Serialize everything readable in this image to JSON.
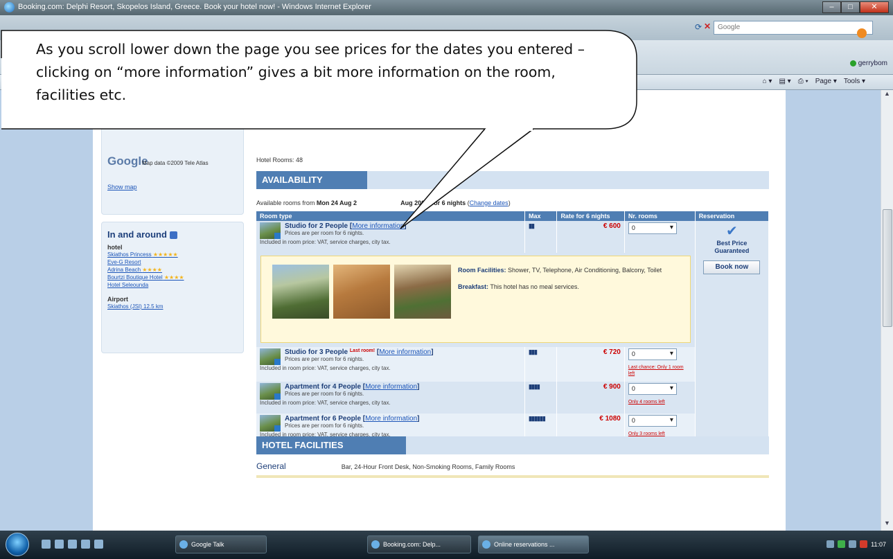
{
  "window": {
    "title": "Booking.com: Delphi Resort, Skopelos Island, Greece. Book your hotel now! - Windows Internet Explorer",
    "search_placeholder": "Google",
    "user_label": "gerrybom"
  },
  "commandbar": {
    "page_label": "Page ▾",
    "tools_label": "Tools ▾"
  },
  "callout": {
    "text": "As you scroll lower down the page you see prices for the dates you entered – clicking on “more information” gives a bit more information on the room, facilities etc."
  },
  "left": {
    "map_brand": "Google",
    "map_credit": "Map data ©2009 Tele Atlas",
    "show_map": "Show map",
    "around_title": "In and around",
    "hotel_heading": "hotel",
    "hotels": [
      {
        "name": "Skiathos Princess",
        "stars": "★★★★★"
      },
      {
        "name": "Eve-G Resort",
        "stars": ""
      },
      {
        "name": "Adrina Beach",
        "stars": "★★★★"
      },
      {
        "name": "Bourtzi Boutique Hotel",
        "stars": "★★★★"
      },
      {
        "name": "Hotel Seleounda",
        "stars": ""
      }
    ],
    "airport_heading": "Airport",
    "airport_link": "Skiathos",
    "airport_distance": "(JSI) 12.5 km"
  },
  "main": {
    "hotel_rooms": "Hotel Rooms: 48",
    "availability_title": "AVAILABILITY",
    "avail_prefix": "Available rooms from",
    "avail_from": "Mon 24 Aug 2",
    "avail_to": "Aug 2009",
    "avail_nights": "for 6 nights",
    "change_dates": "Change dates",
    "columns": [
      "Room type",
      "Max",
      "Rate for 6 nights",
      "Nr. rooms",
      "Reservation"
    ],
    "rooms": [
      {
        "name": "Studio for 2 People",
        "link": "More information",
        "last": "",
        "sub": "Prices are per room for 6 nights.",
        "included": "Included in room price: VAT, service charges, city tax.",
        "max": "▮▮",
        "price": "€ 600",
        "qty": "0",
        "note": ""
      },
      {
        "name": "Studio for 3 People",
        "link": "More information",
        "last": "Last room!",
        "sub": "Prices are per room for 6 nights.",
        "included": "Included in room price: VAT, service charges, city tax.",
        "max": "▮▮▮",
        "price": "€ 720",
        "qty": "0",
        "note": "Last chance: Only 1 room left"
      },
      {
        "name": "Apartment for 4 People",
        "link": "More information",
        "last": "",
        "sub": "Prices are per room for 6 nights.",
        "included": "Included in room price: VAT, service charges, city tax.",
        "max": "▮▮▮▮",
        "price": "€ 900",
        "qty": "0",
        "note": "Only 4 rooms left"
      },
      {
        "name": "Apartment for 6 People",
        "link": "More information",
        "last": "",
        "sub": "Prices are per room for 6 nights.",
        "included": "Included in room price: VAT, service charges, city tax.",
        "max": "▮▮▮▮▮▮",
        "price": "€ 1080",
        "qty": "0",
        "note": "Only 3 rooms left"
      }
    ],
    "info": {
      "facilities_label": "Room Facilities:",
      "facilities_value": "Shower, TV, Telephone, Air Conditioning, Balcony, Toilet",
      "breakfast_label": "Breakfast:",
      "breakfast_value": "This hotel has no meal services."
    },
    "reservation": {
      "best_price": "Best Price Guaranteed",
      "book_now": "Book now"
    },
    "facilities_title": "HOTEL FACILITIES",
    "general_label": "General",
    "general_value": "Bar, 24-Hour Front Desk, Non-Smoking Rooms, Family Rooms"
  },
  "taskbar": {
    "task1": "Google Talk",
    "task2": "Booking.com: Delp...",
    "task3": "Online reservations ...",
    "clock": "11:07"
  }
}
